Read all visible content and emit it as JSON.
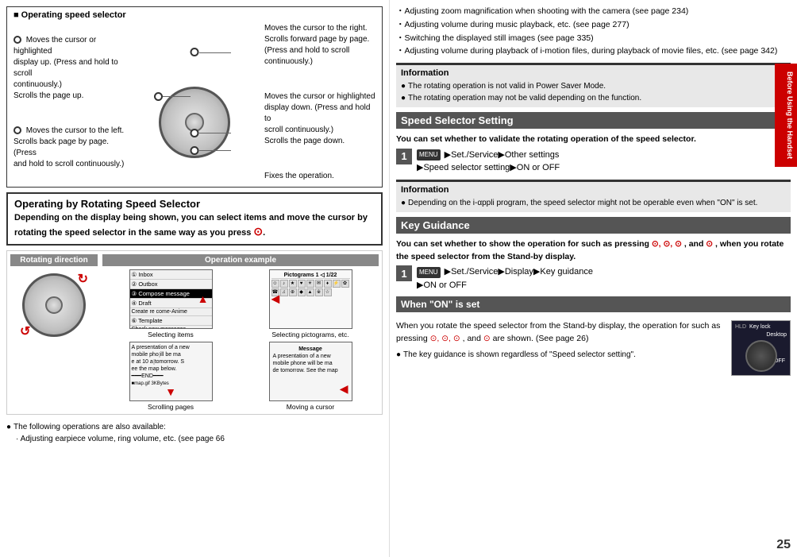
{
  "page": {
    "number": "25",
    "side_tab": "Before Using the Handset"
  },
  "left": {
    "speed_selector_title": "Operating speed selector",
    "left_top_desc": "Moves the cursor or highlighted\ndisplay up. (Press and hold to scroll\ncontinuously.)\nScrolls the page up.",
    "left_mid_desc": "Moves the cursor to the left.\nScrolls back page by page. (Press\nand hold to scroll continuously.)",
    "right_top_desc": "Moves the cursor to the right.\nScrolls forward page by page.\n(Press and hold to scroll\ncontinuously.)",
    "right_bot_desc": "Moves the cursor or highlighted\ndisplay down. (Press and hold to\nscroll continuously.)\nScrolls the page down.",
    "fixes_label": "Fixes the operation.",
    "rotating_box_title": "Operating by Rotating Speed Selector",
    "rotating_box_desc": "Depending on the display being shown, you can select items and move the cursor by rotating the speed selector in the same way as you press",
    "rot_direction_label": "Rotating direction",
    "op_example_label": "Operation example",
    "selecting_items": "Selecting items",
    "selecting_pictograms": "Selecting pictograms, etc.",
    "scrolling_pages": "Scrolling pages",
    "moving_cursor": "Moving a cursor",
    "following_ops_label": "The following operations are also available:",
    "following_ops_item": "Adjusting earpiece volume, ring volume, etc. (see page 66",
    "inbox": "Inbox",
    "outbox": "Outbox",
    "draft": "Draft",
    "compose_message": "Compose message",
    "create_new": "Create re  come-Anime",
    "template": "Template",
    "check_new": "Check new messages"
  },
  "right": {
    "top_bullets": [
      "Adjusting zoom magnification when shooting with the camera (see page 234)",
      "Adjusting volume during music playback, etc. (see page 277)",
      "Switching the displayed still images (see page 335)",
      "Adjusting volume during playback of i-motion files, during playback of movie files, etc. (see page 342)"
    ],
    "info1": {
      "title": "Information",
      "items": [
        "The rotating operation is not valid in Power Saver Mode.",
        "The rotating operation may not be valid depending on the function."
      ]
    },
    "speed_setting_title": "Speed Selector Setting",
    "speed_setting_desc": "You can set whether to validate the rotating operation of the speed selector.",
    "speed_step_content": "Set./Service▶Other settings\n▶Speed selector setting▶ON or OFF",
    "info2": {
      "title": "Information",
      "items": [
        "Depending on the i-αppli program, the speed selector might not be operable even when \"ON\" is set."
      ]
    },
    "key_guidance_title": "Key Guidance",
    "key_guidance_desc": "You can set whether to show the operation for such as pressing",
    "key_guidance_desc2": ", and",
    "key_guidance_desc3": ", when you rotate the speed selector from the Stand-by display.",
    "key_step_content": "Set./Service▶Display▶Key guidance\n▶ON or OFF",
    "when_on_title": "When \"ON\" is set",
    "when_on_text": "When you rotate the speed selector from the Stand-by display, the operation for such as pressing",
    "when_on_text2": ", and",
    "when_on_text3": "are shown. (See page 26)",
    "when_on_bullet": "The key guidance is shown regardless of \"Speed selector setting\".",
    "hld_label": "HLD",
    "key_lock_label": "Key lock",
    "desktop_label": "Desktop",
    "on_off_label": "ON/OFF"
  }
}
